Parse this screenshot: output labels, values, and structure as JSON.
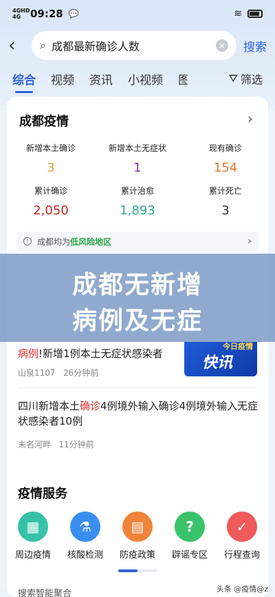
{
  "status": {
    "network": "4GHD 4G",
    "time": "09:28",
    "battery": "100"
  },
  "search": {
    "back": "‹",
    "query": "成都最新确诊人数",
    "clear": "×",
    "button": "搜索"
  },
  "tabs": [
    "综合",
    "视频",
    "资讯",
    "小视频",
    "图"
  ],
  "filter": "筛选",
  "epidemic": {
    "title": "成都疫情",
    "stats": [
      {
        "label": "新增本土确诊",
        "value": "3",
        "color": "#e3a23a"
      },
      {
        "label": "新增本土无症状",
        "value": "1",
        "color": "#7a3aa8"
      },
      {
        "label": "现有确诊",
        "value": "154",
        "color": "#e07a2a"
      },
      {
        "label": "累计确诊",
        "value": "2,050",
        "color": "#c0282a"
      },
      {
        "label": "累计治愈",
        "value": "1,893",
        "color": "#2ba89a"
      },
      {
        "label": "累计死亡",
        "value": "3",
        "color": "#333333"
      }
    ],
    "notice_prefix": "成都均为",
    "notice_low": "低风险地区"
  },
  "banner": {
    "line1": "成都无新增",
    "line2": "病例及无症"
  },
  "news": [
    {
      "title_red": "病例",
      "title_rest": "!新增1例本土无症状感染者",
      "source": "山泉1107",
      "time": "26分钟前",
      "thumb_top": "今日疫情",
      "thumb_main": "快讯"
    },
    {
      "title_pre": "四川新增本土",
      "title_red": "确诊",
      "title_rest": "4例境外输入确诊4例境外输入无症状感染者10例",
      "source": "未名河畔",
      "time": "11分钟前"
    }
  ],
  "services": {
    "title": "疫情服务",
    "items": [
      {
        "label": "周边疫情",
        "icon": "building-icon",
        "color": "#37c2a8"
      },
      {
        "label": "核酸检测",
        "icon": "flask-icon",
        "color": "#3a8ef0"
      },
      {
        "label": "防疫政策",
        "icon": "policy-icon",
        "color": "#f0843a"
      },
      {
        "label": "辟谣专区",
        "icon": "question-icon",
        "color": "#3ac26a"
      },
      {
        "label": "行程查询",
        "icon": "itinerary-icon",
        "color": "#f05a5a"
      }
    ]
  },
  "bottom_text": "搜索智能聚合",
  "watermark": "头条 @疫情@z"
}
